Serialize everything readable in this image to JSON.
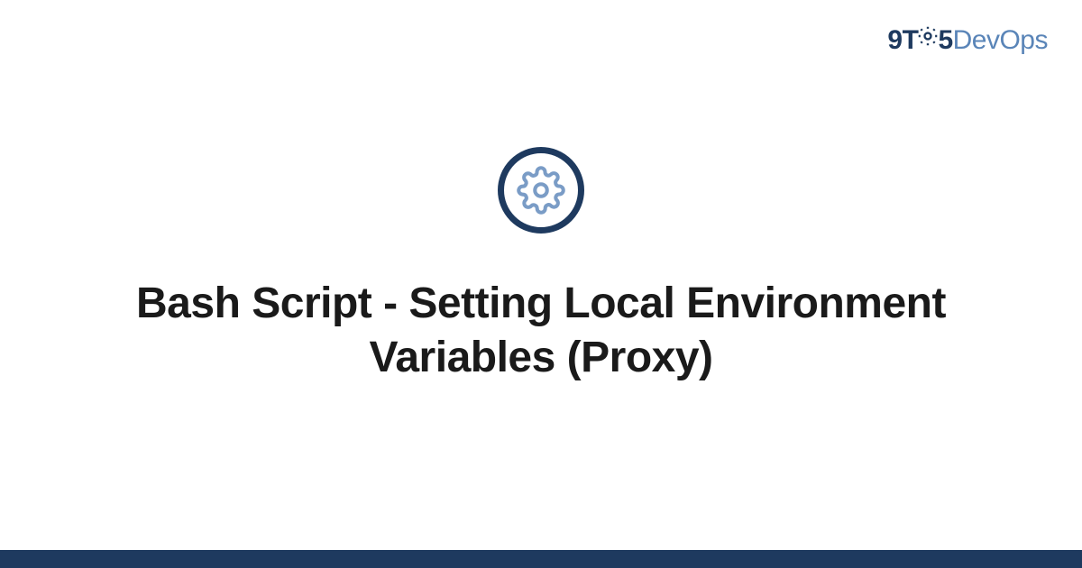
{
  "brand": {
    "part1": "9T",
    "part2": "5",
    "part3": "DevOps"
  },
  "title": "Bash Script - Setting Local Environment Variables (Proxy)",
  "colors": {
    "dark_blue": "#1e3a5f",
    "light_blue": "#7a9cc6"
  }
}
